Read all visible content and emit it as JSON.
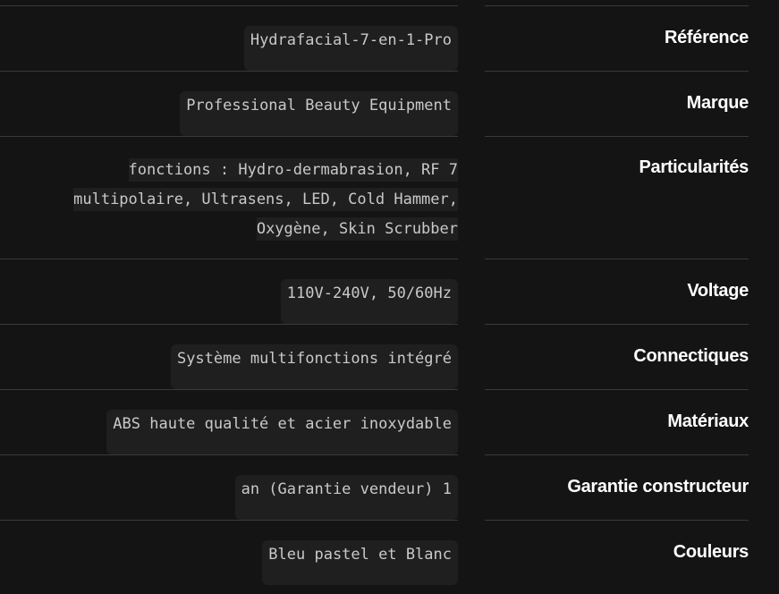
{
  "specs": [
    {
      "label": "Référence",
      "value": "Hydrafacial-7-en-1-Pro"
    },
    {
      "label": "Marque",
      "value": "Professional Beauty Equipment"
    },
    {
      "label": "Particularités",
      "value": "fonctions : Hydro-dermabrasion, RF 7 multipolaire, Ultrasens, LED, Cold Hammer, Oxygène, Skin Scrubber"
    },
    {
      "label": "Voltage",
      "value": "110V-240V, 50/60Hz"
    },
    {
      "label": "Connectiques",
      "value": "Système multifonctions intégré"
    },
    {
      "label": "Matériaux",
      "value": "ABS haute qualité et acier inoxydable"
    },
    {
      "label": "Garantie constructeur",
      "value": "an (Garantie vendeur) 1"
    },
    {
      "label": "Couleurs",
      "value": "Bleu pastel et Blanc"
    }
  ]
}
